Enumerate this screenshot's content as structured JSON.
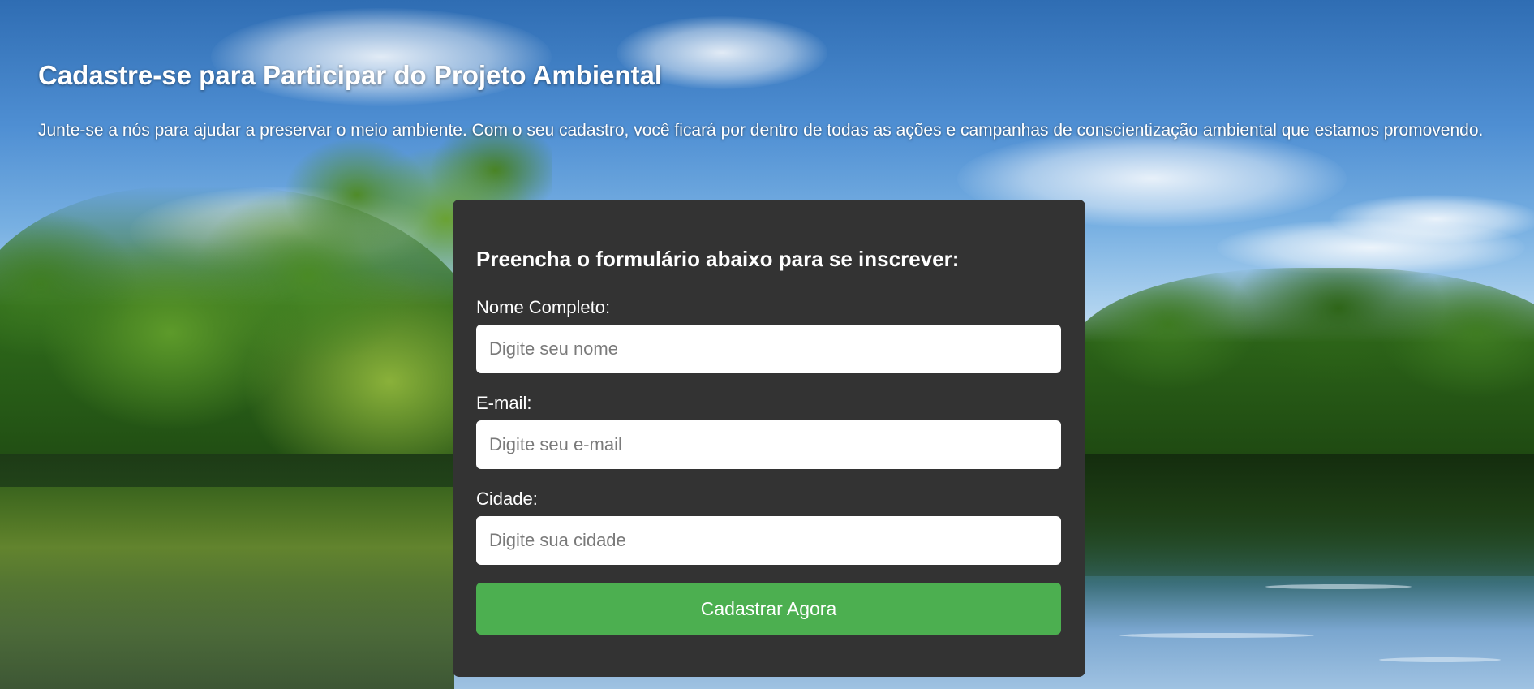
{
  "header": {
    "title": "Cadastre-se para Participar do Projeto Ambiental",
    "description": "Junte-se a nós para ajudar a preservar o meio ambiente. Com o seu cadastro, você ficará por dentro de todas as ações e campanhas de conscientização ambiental que estamos promovendo."
  },
  "form": {
    "heading": "Preencha o formulário abaixo para se inscrever:",
    "fields": [
      {
        "label": "Nome Completo:",
        "placeholder": "Digite seu nome",
        "value": ""
      },
      {
        "label": "E-mail:",
        "placeholder": "Digite seu e-mail",
        "value": ""
      },
      {
        "label": "Cidade:",
        "placeholder": "Digite sua cidade",
        "value": ""
      }
    ],
    "submit_label": "Cadastrar Agora"
  },
  "colors": {
    "card_background": "#333333",
    "submit_button": "#4caf50",
    "text": "#ffffff"
  }
}
